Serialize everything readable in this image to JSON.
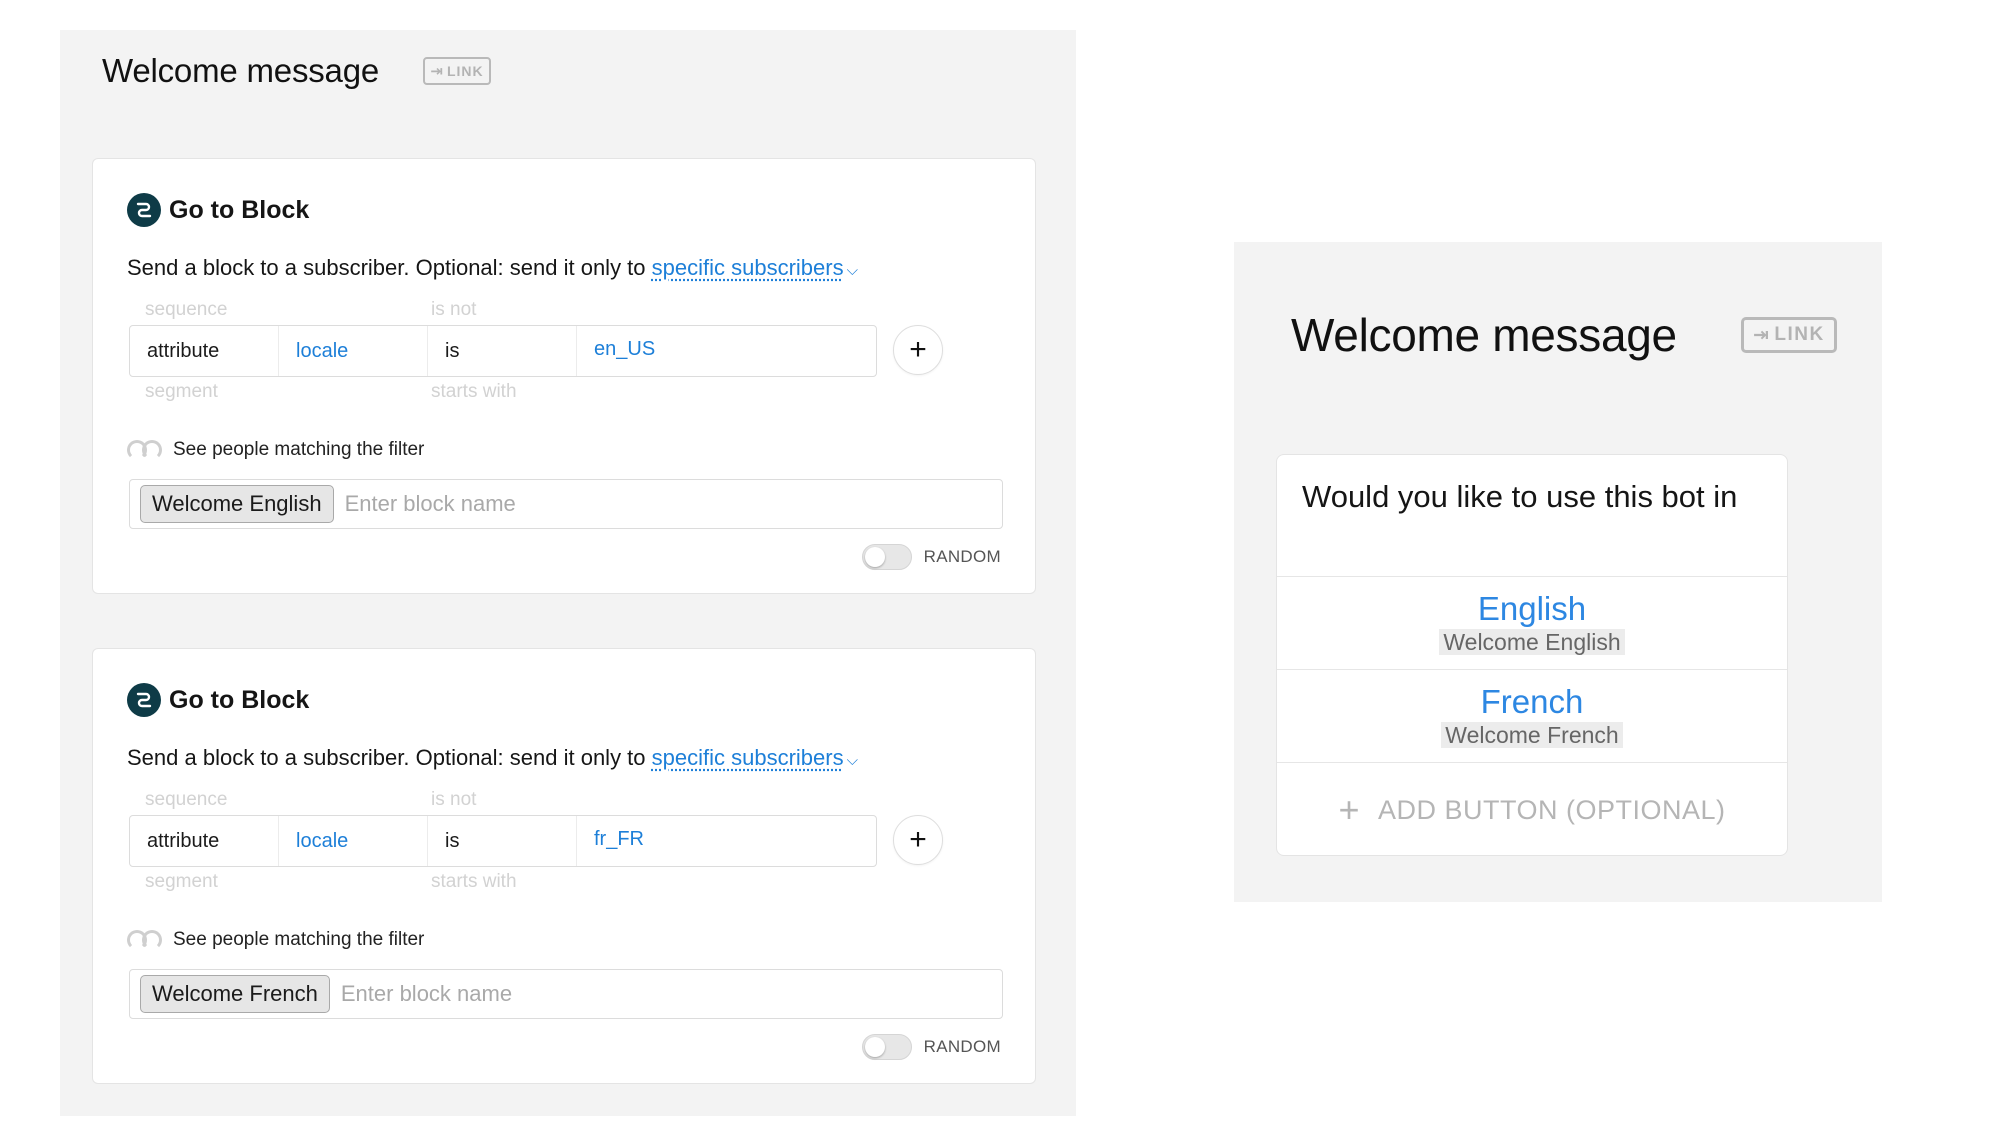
{
  "editor": {
    "title": "Welcome message",
    "link_label": "LINK",
    "cards": [
      {
        "title": "Go to Block",
        "description": "Send a block to a subscriber. Optional: send it only to",
        "description_link": "specific subscribers",
        "ghost_top_1": "sequence",
        "ghost_top_2": "is not",
        "ghost_bottom_1": "segment",
        "ghost_bottom_2": "starts with",
        "filter": {
          "type": "attribute",
          "name": "locale",
          "operator": "is",
          "value": "en_US"
        },
        "add_filter": "+",
        "people_label": "See people matching the filter",
        "block_chip": "Welcome English",
        "block_placeholder": "Enter block name",
        "random_label": "RANDOM"
      },
      {
        "title": "Go to Block",
        "description": "Send a block to a subscriber. Optional: send it only to",
        "description_link": "specific subscribers",
        "ghost_top_1": "sequence",
        "ghost_top_2": "is not",
        "ghost_bottom_1": "segment",
        "ghost_bottom_2": "starts with",
        "filter": {
          "type": "attribute",
          "name": "locale",
          "operator": "is",
          "value": "fr_FR"
        },
        "add_filter": "+",
        "people_label": "See people matching the filter",
        "block_chip": "Welcome French",
        "block_placeholder": "Enter block name",
        "random_label": "RANDOM"
      }
    ]
  },
  "preview": {
    "title": "Welcome message",
    "link_label": "LINK",
    "question": "Would you like to use this bot in",
    "buttons": [
      {
        "label": "English",
        "target": "Welcome English"
      },
      {
        "label": "French",
        "target": "Welcome French"
      }
    ],
    "add_button": "ADD BUTTON (OPTIONAL)"
  },
  "colors": {
    "accent_blue": "#1d7fd8",
    "icon_teal": "#0e3b47",
    "panel_bg": "#f3f3f3"
  }
}
